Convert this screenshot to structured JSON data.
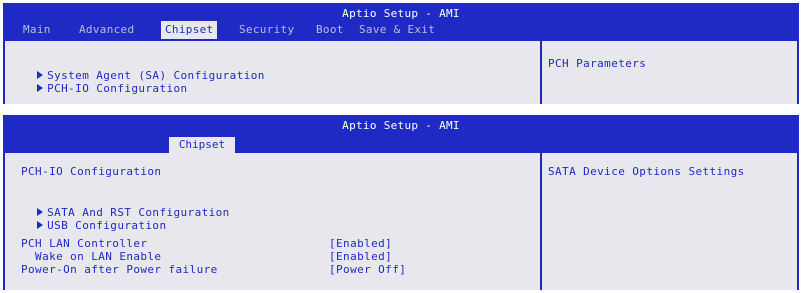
{
  "screen1": {
    "title": "Aptio Setup - AMI",
    "tabs": [
      {
        "label": "Main"
      },
      {
        "label": "Advanced"
      },
      {
        "label": "Chipset"
      },
      {
        "label": "Security"
      },
      {
        "label": "Boot"
      },
      {
        "label": "Save & Exit"
      }
    ],
    "active_tab": "Chipset",
    "items": [
      {
        "label": "System Agent (SA) Configuration"
      },
      {
        "label": "PCH-IO Configuration"
      }
    ],
    "help": "PCH Parameters"
  },
  "screen2": {
    "title": "Aptio Setup - AMI",
    "tab": "Chipset",
    "heading": "PCH-IO Configuration",
    "submenus": [
      {
        "label": "SATA And RST Configuration"
      },
      {
        "label": "USB Configuration"
      }
    ],
    "settings": [
      {
        "label": "PCH LAN Controller",
        "value": "[Enabled]"
      },
      {
        "label": "  Wake on LAN Enable",
        "value": "[Enabled]"
      },
      {
        "label": "Power-On after Power failure",
        "value": "[Power Off]"
      }
    ],
    "help": "SATA Device Options Settings"
  },
  "colors": {
    "header_blue": "#1f2ac4",
    "panel_gray": "#e7e7ed",
    "header_text": "#ffffff",
    "inactive_tab_text": "#b8bfd6"
  }
}
